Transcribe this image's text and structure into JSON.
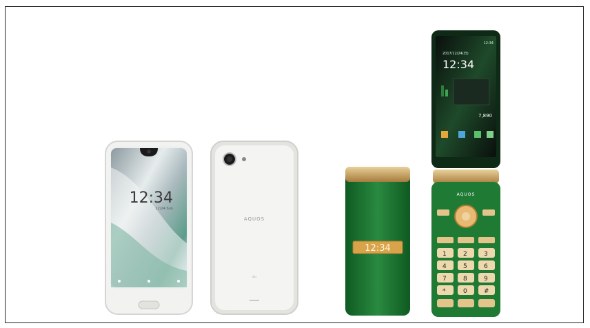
{
  "phones": {
    "smartphone_front": {
      "time": "12:34",
      "date": "12/24 Sun"
    },
    "smartphone_back": {
      "brand": "AQUOS"
    },
    "flip_closed": {
      "time": "12:34"
    },
    "flip_open": {
      "status_time": "12:34",
      "date": "2017/12/24(日)",
      "time": "12:34",
      "steps": "7,890",
      "brand": "AQUOS",
      "keypad": [
        "1",
        "2",
        "3",
        "4",
        "5",
        "6",
        "7",
        "8",
        "9",
        "*",
        "0",
        "#"
      ]
    }
  },
  "colors": {
    "white_body": "#f1f1ef",
    "silver_trim": "#d7d7d4",
    "green_body": "#1f7a34",
    "gold": "#c9a45a",
    "screen_dark": "#101512"
  }
}
